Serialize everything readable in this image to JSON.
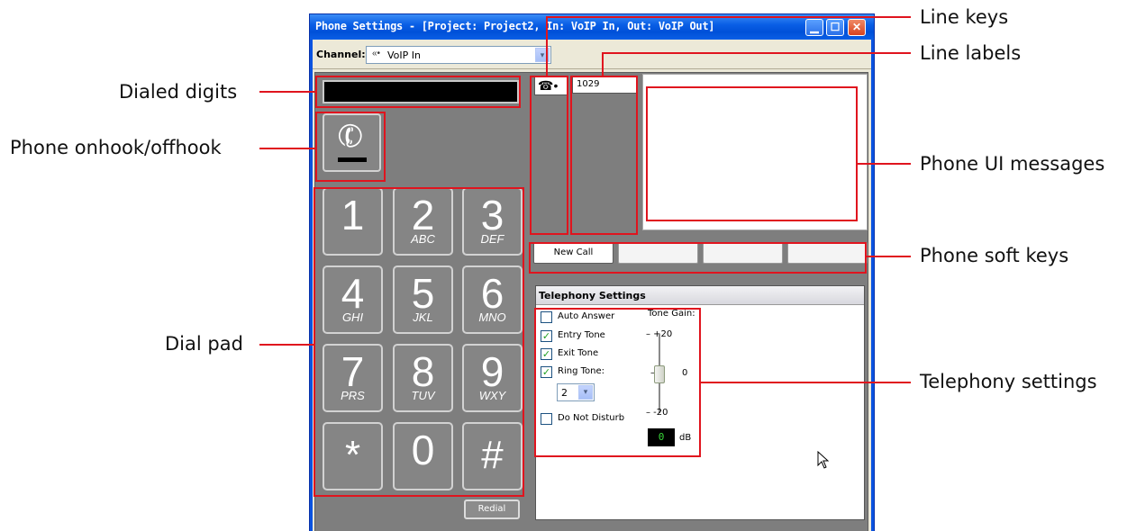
{
  "window": {
    "title": "Phone Settings - [Project: Project2, In: VoIP In, Out: VoIP Out]",
    "min_glyph": "▁",
    "max_glyph": "☐",
    "close_glyph": "✕"
  },
  "channel": {
    "label": "Channel:",
    "value": "VoIP In",
    "icon": "«•",
    "arrow": "▾"
  },
  "display": {
    "digits": ""
  },
  "hook": {
    "glyph": "✆"
  },
  "keypad": {
    "keys": [
      {
        "digit": "1",
        "letters": ""
      },
      {
        "digit": "2",
        "letters": "ABC"
      },
      {
        "digit": "3",
        "letters": "DEF"
      },
      {
        "digit": "4",
        "letters": "GHI"
      },
      {
        "digit": "5",
        "letters": "JKL"
      },
      {
        "digit": "6",
        "letters": "MNO"
      },
      {
        "digit": "7",
        "letters": "PRS"
      },
      {
        "digit": "8",
        "letters": "TUV"
      },
      {
        "digit": "9",
        "letters": "WXY"
      },
      {
        "digit": "*",
        "letters": ""
      },
      {
        "digit": "0",
        "letters": ""
      },
      {
        "digit": "#",
        "letters": ""
      }
    ],
    "redial_label": "Redial"
  },
  "lines": {
    "key_glyph": "☎•",
    "label": "1029"
  },
  "softkeys": [
    "New Call",
    "",
    "",
    ""
  ],
  "telephony": {
    "header": "Telephony Settings",
    "auto_answer": {
      "label": "Auto Answer",
      "mark": ""
    },
    "entry_tone": {
      "label": "Entry Tone",
      "mark": "✓"
    },
    "exit_tone": {
      "label": "Exit Tone",
      "mark": "✓"
    },
    "ring_tone": {
      "label": "Ring Tone:",
      "mark": "✓",
      "value": "2"
    },
    "do_not_disturb": {
      "label": "Do Not Disturb",
      "mark": ""
    },
    "tone_gain": {
      "label": "Tone Gain:",
      "tick_top": "– +20",
      "tick_mid": "0",
      "tick_bottom": "– -20",
      "value": "0",
      "unit": "dB"
    }
  },
  "callouts": {
    "line_keys": "Line keys",
    "line_labels": "Line labels",
    "dialed_digits": "Dialed digits",
    "phone_hook": "Phone onhook/offhook",
    "phone_ui_messages": "Phone UI messages",
    "phone_soft_keys": "Phone soft keys",
    "dial_pad": "Dial pad",
    "telephony_settings": "Telephony settings"
  },
  "colors": {
    "title_bar": "#0a5fe6",
    "panel": "#7e7e7e",
    "annotation": "#e0141e",
    "check": "#21a121"
  }
}
